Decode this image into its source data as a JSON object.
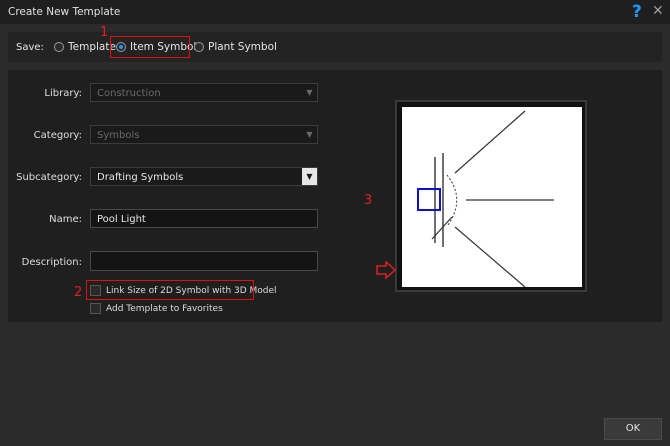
{
  "window": {
    "title": "Create New Template"
  },
  "save": {
    "label": "Save:",
    "options": [
      {
        "label": "Template",
        "selected": false
      },
      {
        "label": "Item Symbol",
        "selected": true
      },
      {
        "label": "Plant Symbol",
        "selected": false
      }
    ]
  },
  "form": {
    "library": {
      "label": "Library:",
      "value": "Construction",
      "enabled": false
    },
    "category": {
      "label": "Category:",
      "value": "Symbols",
      "enabled": false
    },
    "subcategory": {
      "label": "Subcategory:",
      "value": "Drafting Symbols",
      "enabled": true
    },
    "name": {
      "label": "Name:",
      "value": "Pool Light"
    },
    "description": {
      "label": "Description:",
      "value": ""
    }
  },
  "options": {
    "link_size": {
      "label": "Link Size of 2D Symbol with 3D Model",
      "checked": false
    },
    "add_favorites": {
      "label": "Add Template to Favorites",
      "checked": false
    }
  },
  "callouts": {
    "one": "1",
    "two": "2",
    "three": "3"
  },
  "buttons": {
    "ok": "OK"
  },
  "colors": {
    "accent": "#1a9bff",
    "callout": "#e02020",
    "selection_box": "#1010d0"
  }
}
